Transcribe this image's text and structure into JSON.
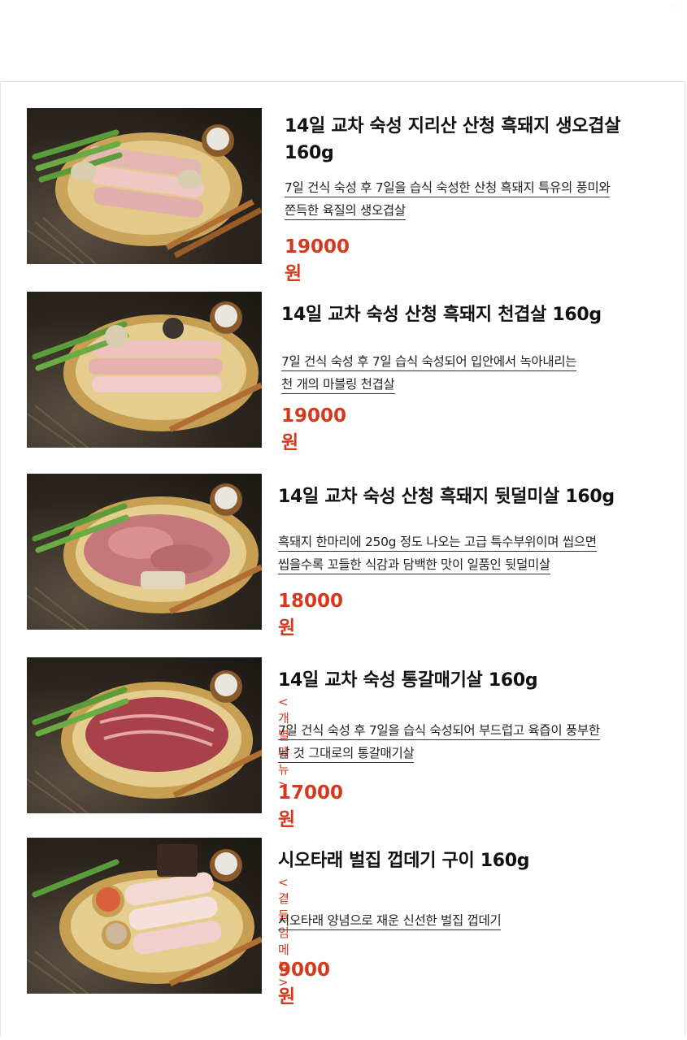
{
  "items": [
    {
      "title_lines": [
        "14일 교차 숙성 지리산 산청 흑돼지 생오겹살",
        "160g"
      ],
      "tag": "",
      "desc_lines": [
        "7일 건식 숙성 후 7일을 습식 숙성한 산청 흑돼지 특유의 풍미와",
        "쫀득한 육질의 생오겹살"
      ],
      "price": "19000원",
      "photo": "meat-platter-pork-belly"
    },
    {
      "title_lines": [
        "14일 교차 숙성 산청 흑돼지 천겹살 160g"
      ],
      "tag": "",
      "desc_lines": [
        "7일 건식 숙성 후 7일 습식 숙성되어 입안에서 녹아내리는",
        "천 개의 마블링 천겹살"
      ],
      "price": "19000원",
      "photo": "meat-platter-thin-pork"
    },
    {
      "title_lines": [
        "14일 교차 숙성 산청 흑돼지 뒷덜미살 160g"
      ],
      "tag": "",
      "desc_lines": [
        "흑돼지 한마리에 250g 정도 나오는 고급 특수부위이며 씹으면",
        "씹을수록 꼬들한 식감과 담백한 맛이 일품인 뒷덜미살"
      ],
      "price": "18000원",
      "photo": "meat-platter-neck"
    },
    {
      "title_lines": [
        "14일 교차 숙성 통갈매기살 160g"
      ],
      "tag": "<개별 메뉴>",
      "desc_lines": [
        "7일 건식 숙성 후 7일을 습식 숙성되어 부드럽고 육즙이 풍부한",
        "날 것 그대로의 통갈매기살"
      ],
      "price": "17000원",
      "photo": "meat-platter-skirt"
    },
    {
      "title_lines": [
        "시오타래 벌집 껍데기 구이 160g"
      ],
      "tag": "<곁들임 메뉴>",
      "desc_lines": [
        "시오타래 양념으로 재운 신선한 벌집 껍데기"
      ],
      "price": "9000원",
      "photo": "meat-platter-pork-skin"
    }
  ],
  "colors": {
    "accent": "#d2391e",
    "text": "#111111"
  }
}
